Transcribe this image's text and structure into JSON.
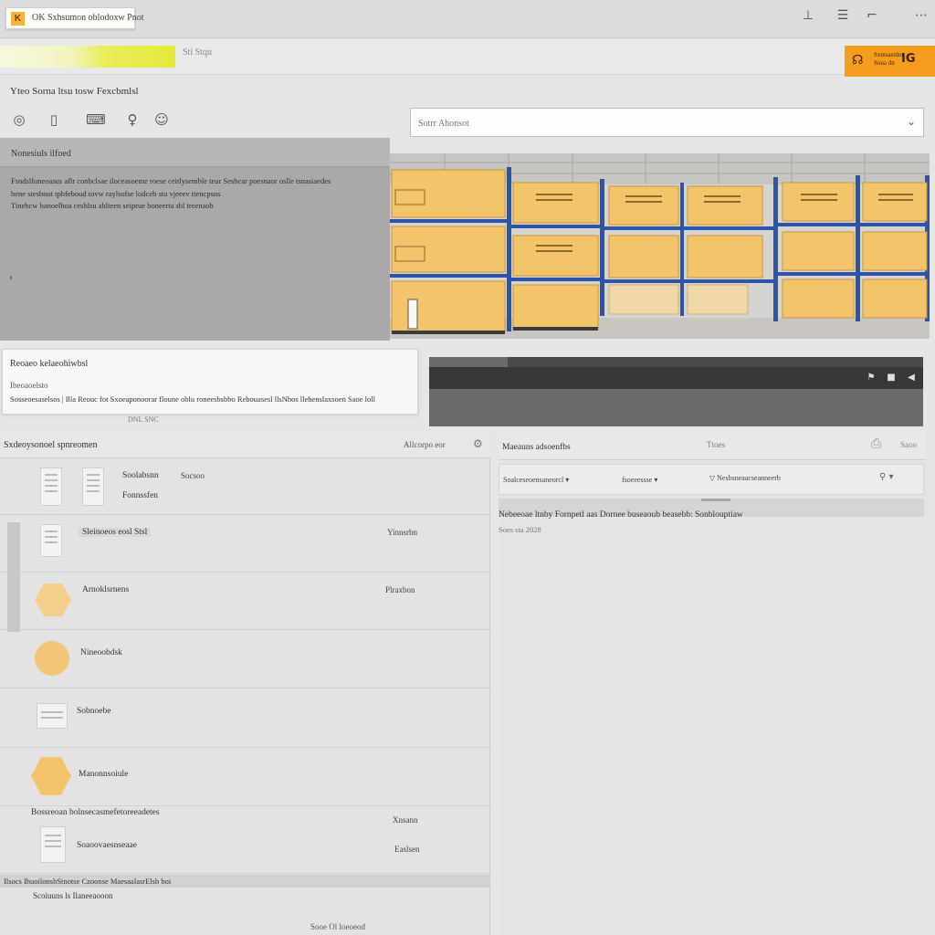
{
  "window": {
    "tab_title": "OK Sxhsumon oblodoxw Pnot",
    "logo_glyph": "K",
    "icons": [
      "pin-icon",
      "menu-icon",
      "crop-icon",
      "more-icon"
    ],
    "icon_glyphs": [
      "⊥",
      "☰",
      "⌐",
      "⋯"
    ]
  },
  "toolbar": {
    "address_text": "Sti Stqu",
    "action": {
      "line1": "Sxmsasnlnn",
      "line2": "Soua dn",
      "glyph": "IG"
    }
  },
  "hero": {
    "title": "Yteo Sorna ltsu tosw Fexcbmlsl",
    "tool_icons": [
      "headset-icon",
      "phone-icon",
      "keyboard-icon",
      "bulb-icon",
      "profile-icon"
    ],
    "tool_glyphs": [
      "◎",
      "▯",
      "⌨",
      "♀",
      "☺"
    ],
    "search": {
      "placeholder": "Sotrr Ahonsot",
      "chevron": "⌄"
    }
  },
  "info_panel": {
    "heading": "Nonesiuls ilfoed",
    "lines": [
      "Fsndslfuneoasus aflr conbclsae iloceasoeme roese ceitlysemble teur Sesbcar poesnaor oslle tsnasiaedes",
      "bene stesbnot tpbfeboud tovw raylsofse lodceb stu vjeeev ttencpsns",
      "Tinebcw banoelhoa cesblsu ahlteen seiprue boneerta sbl treenaob"
    ],
    "arrow": "›"
  },
  "notice": {
    "title": "Reoaeo kelaeohiwbsl",
    "subtitle": "Ibeoaoelsto",
    "body": "Sosseoesaselsos | Illa  Reouc fot Sxoeaponoorar floune oblu roneesbsbbo Rebouasesl llsNbos llehenslaxsoen Saoe loll",
    "footer": "DNL   SNC"
  },
  "player": {
    "controls": [
      "bookmark-icon",
      "stop-icon",
      "volume-icon"
    ],
    "glyphs": [
      "⚑",
      "■",
      "◀"
    ]
  },
  "list_panel": {
    "title": "Sxdeoysonoel spnreomen",
    "action_label": "Allcorpo eor",
    "action_icon": "⚙",
    "rows": [
      {
        "label": "Soolabsnn",
        "sub": "Fonnssfen",
        "right": "Socsoo"
      },
      {
        "label": "Sleinoeos eosl Stsl",
        "right": "Yinnsrbn"
      },
      {
        "label": "Arnoklsrnens",
        "right": "Plraxbon"
      },
      {
        "label": "Nineoobdsk"
      },
      {
        "label": "Sobnoebe"
      },
      {
        "label": "Manonnsoiule"
      },
      {
        "label": "Bossreoan bolnsecasmefetoreeadetes",
        "sub": "Soaoovaesnseaae",
        "right": "Xnsann",
        "right2": "Easlsen"
      }
    ],
    "footer_row": "Ilsocs IhuoilonsbStnotse  Czoonse MaesaalasrElsb boi",
    "footer_link": "Scoiuuns  ls  Ilaneeaooon",
    "footer_bottom": "Sooe Ol loeoeod"
  },
  "right_panel": {
    "title": "Maeauns adsoenfbs",
    "meta": "Ttoes",
    "icon": "⎙",
    "extra": "Saoo",
    "filters": [
      "Soalceseoensaneorcl    ▾",
      "fsoeeessse   ▾",
      "▽ Nesbsneaacseanneerb",
      "⚲   ▾"
    ],
    "description": "Nebeeoae ltnby Fornpetl  aas Dornee buseaoub beasebb: Sonblouptiaw",
    "date": "Soes sta 2028"
  },
  "colors": {
    "accent_orange": "#f49d1e",
    "brand_yellow": "#e4ea3a",
    "box_amber": "#f3c56a",
    "rack_blue": "#2e54a8"
  }
}
